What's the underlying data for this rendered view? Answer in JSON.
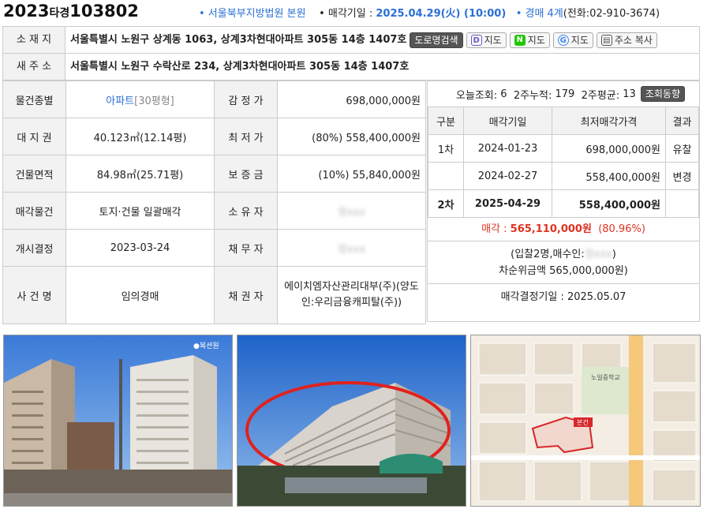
{
  "header": {
    "case_year": "2023",
    "case_type": "타경",
    "case_num": "103802",
    "court": "• 서울북부지방법원 본원",
    "sale_date_label": "• 매각기일 : ",
    "sale_date": "2025.04.29(火) (10:00)",
    "dept_label": "• 경매 4계",
    "phone": "(전화:02-910-3674)"
  },
  "address": {
    "label": "소 재 지",
    "value": "서울특별시 노원구 상계동 1063, 상계3차현대아파트 305동 14층 1407호",
    "road_label": "새 주 소",
    "road_value": "서울특별시 노원구 수락산로 234, 상계3차현대아파트 305동 14층 1407호",
    "buttons": {
      "road_search": "도로명검색",
      "daum_map": "지도",
      "naver_map": "지도",
      "google_map": "지도",
      "copy": "주소 복사"
    }
  },
  "info": {
    "type_label": "물건종별",
    "type_value": "아파트",
    "type_size": "[30평형]",
    "land_label": "대 지 권",
    "land_value": "40.123㎡(12.14평)",
    "bldg_label": "건물면적",
    "bldg_value": "84.98㎡(25.71평)",
    "sale_obj_label": "매각물건",
    "sale_obj_value": "토지·건물 일괄매각",
    "start_label": "개시결정",
    "start_value": "2023-03-24",
    "case_name_label": "사 건 명",
    "case_name_value": "임의경매",
    "appraisal_label": "감 정 가",
    "appraisal_value": "698,000,000원",
    "min_label": "최 저 가",
    "min_value": "(80%) 558,400,000원",
    "deposit_label": "보 증 금",
    "deposit_value": "(10%) 55,840,000원",
    "owner_label": "소 유 자",
    "owner_value": "정xxx",
    "debtor_label": "채 무 자",
    "debtor_value": "정xxx",
    "creditor_label": "채 권 자",
    "creditor_value": "에이치엠자산관리대부(주)(양도인:우리금융캐피탈(주))"
  },
  "stats": {
    "today_label": "오늘조회:",
    "today": "6",
    "two_week_label": "2주누적:",
    "two_week": "179",
    "avg_label": "2주평균:",
    "avg": "13",
    "trend_button": "조회동향"
  },
  "history": {
    "headers": [
      "구분",
      "매각기일",
      "최저매각가격",
      "결과"
    ],
    "rows": [
      [
        "1차",
        "2024-01-23",
        "698,000,000원",
        "유찰"
      ],
      [
        "",
        "2024-02-27",
        "558,400,000원",
        "변경"
      ],
      [
        "2차",
        "2025-04-29",
        "558,400,000원",
        ""
      ]
    ]
  },
  "result": {
    "sale_label": "매각 : ",
    "sale_price": "565,110,000원",
    "sale_ratio": "(80.96%)",
    "bid_line1": "(입찰2명,매수인:",
    "bid_buyer": "정xxx",
    "bid_line1_end": ")",
    "bid_line2": "차순위금액 565,000,000원)",
    "decide_label": "매각결정기일 : 2025.05.07"
  },
  "colors": {
    "blue": "#2a6fd6",
    "red": "#d32222",
    "label_bg": "#f2f2f2"
  }
}
